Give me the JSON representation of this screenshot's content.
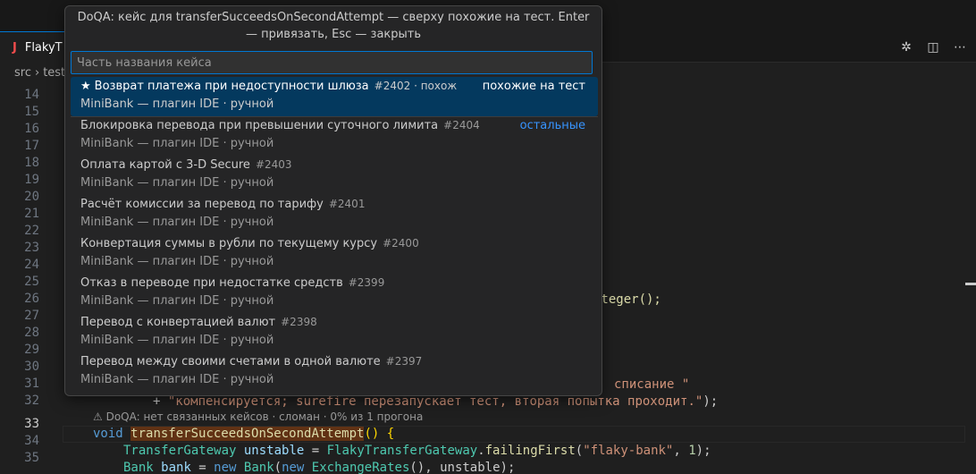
{
  "tab": {
    "label": "FlakyT"
  },
  "breadcrumbs": [
    "src",
    "test"
  ],
  "gutter": {
    "lines": [
      "14",
      "15",
      "16",
      "17",
      "18",
      "19",
      "20",
      "21",
      "22",
      "23",
      "24",
      "25",
      "26",
      "27",
      "28",
      "29",
      "30",
      "31",
      "32",
      "33",
      "34",
      "35"
    ],
    "active": "33"
  },
  "code": {
    "line26_tail": "nteger();",
    "line31_tail": "списание \"",
    "line32_plus": "+ ",
    "line32_str": "\"компенсируется; surefire перезапускает тест, вторая попытка проходит.\"",
    "line32_end": ");",
    "codelens": "⚠ DoQA: нет связанных кейсов · сломан · 0% из 1 прогона",
    "line33_kw": "void",
    "line33_fn": "transferSucceedsOnSecondAttempt",
    "line33_parens": "() {",
    "line34_type": "TransferGateway",
    "line34_var": "unstable",
    "line34_eq": " = ",
    "line34_cls": "FlakyTransferGateway",
    "line34_dot": ".",
    "line34_fn": "failingFirst",
    "line34_str": "\"flaky-bank\"",
    "line34_comma": ", ",
    "line34_num": "1",
    "line34_end": ");",
    "line35_type": "Bank",
    "line35_var": "bank",
    "line35_eq": " = ",
    "line35_new": "new",
    "line35_cls": "Bank",
    "line35_new2": "new",
    "line35_cls2": "ExchangeRates",
    "line35_tail": "(), unstable);"
  },
  "quickpick": {
    "title": "DoQA: кейс для transferSucceedsOnSecondAttempt — сверху похожие на тест. Enter — привязать, Esc — закрыть",
    "placeholder": "Часть названия кейса",
    "items": [
      {
        "label": "Возврат платежа при недоступности шлюза",
        "desc": "#2402 · похож",
        "detail": "MiniBank — плагин IDE · ручной",
        "separator": "похожие на тест",
        "starred": true
      },
      {
        "label": "Блокировка перевода при превышении суточного лимита",
        "desc": "#2404",
        "detail": "MiniBank — плагин IDE · ручной",
        "separator": "остальные"
      },
      {
        "label": "Оплата картой с 3-D Secure",
        "desc": "#2403",
        "detail": "MiniBank — плагин IDE · ручной"
      },
      {
        "label": "Расчёт комиссии за перевод по тарифу",
        "desc": "#2401",
        "detail": "MiniBank — плагин IDE · ручной"
      },
      {
        "label": "Конвертация суммы в рубли по текущему курсу",
        "desc": "#2400",
        "detail": "MiniBank — плагин IDE · ручной"
      },
      {
        "label": "Отказ в переводе при недостатке средств",
        "desc": "#2399",
        "detail": "MiniBank — плагин IDE · ручной"
      },
      {
        "label": "Перевод с конвертацией валют",
        "desc": "#2398",
        "detail": "MiniBank — плагин IDE · ручной"
      },
      {
        "label": "Перевод между своими счетами в одной валюте",
        "desc": "#2397",
        "detail": "MiniBank — плагин IDE · ручной"
      }
    ]
  },
  "colors": {
    "accent": "#0078d4",
    "selection": "#04395e",
    "separator_link": "#3794ff"
  }
}
